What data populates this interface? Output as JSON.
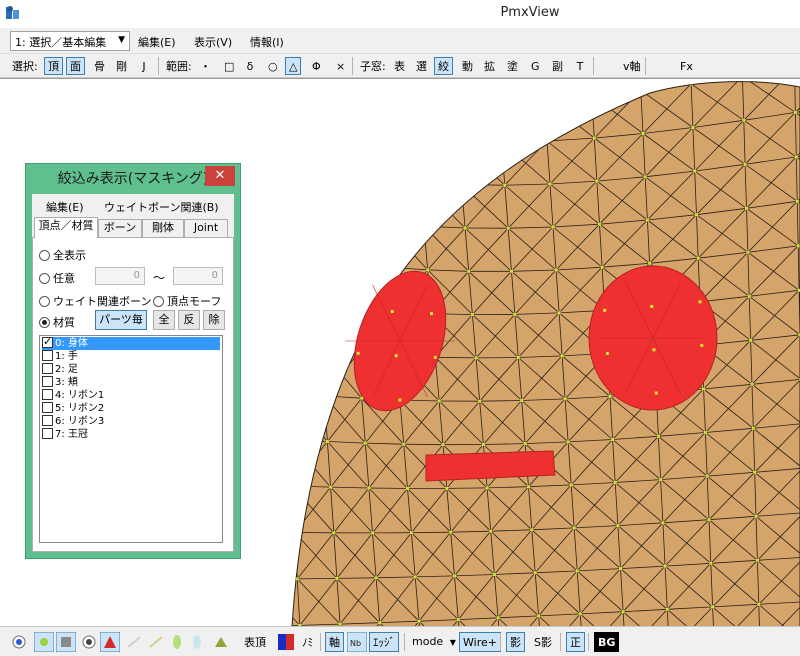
{
  "app": {
    "title": "PmxView"
  },
  "menubar": {
    "mode_selected": "1: 選択／基本編集",
    "items": [
      "編集(E)",
      "表示(V)",
      "情報(I)"
    ]
  },
  "toolbar": {
    "select_label": "選択:",
    "select_items": [
      {
        "label": "頂",
        "on": true
      },
      {
        "label": "面",
        "on": true
      },
      {
        "label": "骨",
        "on": false
      },
      {
        "label": "剛",
        "on": false
      },
      {
        "label": "J",
        "on": false
      }
    ],
    "range_label": "範囲:",
    "range_items": [
      {
        "label": "・",
        "on": false
      },
      {
        "label": "□",
        "on": false
      },
      {
        "label": "δ",
        "on": false
      },
      {
        "label": "○",
        "on": false
      },
      {
        "label": "△",
        "on": true
      },
      {
        "label": "Φ",
        "on": false
      },
      {
        "label": "×",
        "on": false
      }
    ],
    "subwin_label": "子窓:",
    "subwin_items": [
      {
        "label": "表",
        "on": false
      },
      {
        "label": "選",
        "on": false
      },
      {
        "label": "絞",
        "on": true
      },
      {
        "label": "動",
        "on": false
      },
      {
        "label": "拡",
        "on": false
      },
      {
        "label": "塗",
        "on": false
      },
      {
        "label": "G",
        "on": false
      },
      {
        "label": "副",
        "on": false
      },
      {
        "label": "T",
        "on": false
      }
    ],
    "v_axis_label": "v軸",
    "fx_label": "Fx"
  },
  "dialog": {
    "title": "絞込み表示(マスキング)",
    "close": "✕",
    "menu": [
      "編集(E)",
      "ウェイトボーン関連(B)"
    ],
    "tabs": [
      {
        "label": "頂点／材質",
        "active": true
      },
      {
        "label": "ボーン",
        "active": false
      },
      {
        "label": "剛体",
        "active": false
      },
      {
        "label": "Joint",
        "active": false
      }
    ],
    "show_all": "全表示",
    "arbitrary": "任意",
    "range_from": "0",
    "range_sep": "〜",
    "range_to": "0",
    "weight_bone": "ウェイト関連ボーン",
    "vertex_morph": "頂点モーフ",
    "material": "材質",
    "per_part": "パーツ毎",
    "all_btn": "全",
    "invert_btn": "反",
    "remove_btn": "除",
    "materials": [
      {
        "label": "0: 身体",
        "checked": true,
        "selected": true
      },
      {
        "label": "1: 手",
        "checked": false,
        "selected": false
      },
      {
        "label": "2: 足",
        "checked": false,
        "selected": false
      },
      {
        "label": "3: 頬",
        "checked": false,
        "selected": false
      },
      {
        "label": "4: リボン1",
        "checked": false,
        "selected": false
      },
      {
        "label": "5: リボン2",
        "checked": false,
        "selected": false
      },
      {
        "label": "6: リボン3",
        "checked": false,
        "selected": false
      },
      {
        "label": "7: 王冠",
        "checked": false,
        "selected": false
      }
    ]
  },
  "bottombar": {
    "front_vertex": "表頂",
    "no_label": "ﾉﾐ",
    "axis": "軸",
    "edge": "ｴｯｼﾞ",
    "mode": "mode",
    "wire": "Wire+",
    "shadow": "影",
    "s_shadow": "S影",
    "ortho": "正",
    "bg": "BG"
  },
  "colors": {
    "skin": "#d4a46a",
    "eye": "#ee3030",
    "mesh": "#2a2018",
    "vertex": "#c8e632",
    "dialog_frame": "#5fbf8f",
    "selection": "#3399ff"
  }
}
